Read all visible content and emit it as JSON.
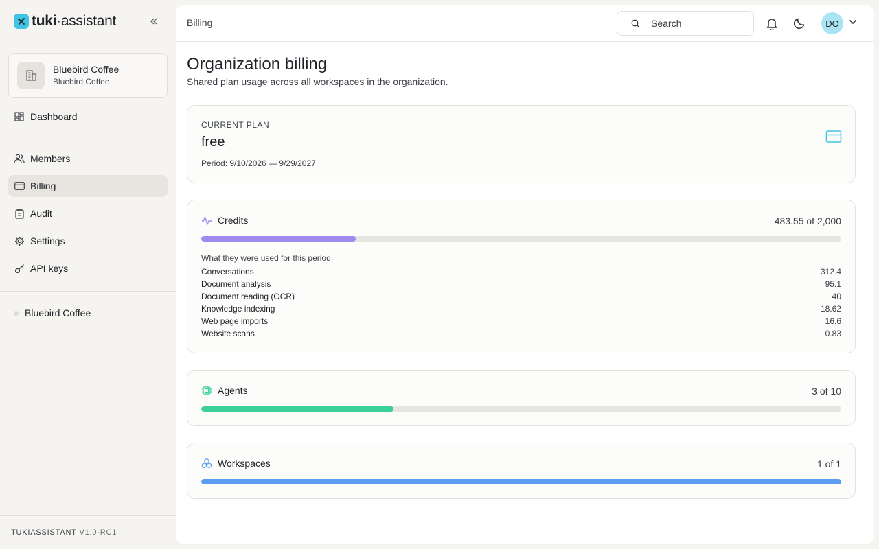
{
  "brand": {
    "name_bold": "tuki",
    "name_sep": "·",
    "name_rest": "assistant"
  },
  "org": {
    "name": "Bluebird Coffee",
    "subtitle": "Bluebird Coffee"
  },
  "nav": {
    "dashboard": "Dashboard",
    "members": "Members",
    "billing": "Billing",
    "audit": "Audit",
    "settings": "Settings",
    "api_keys": "API keys"
  },
  "workspaces": [
    {
      "name": "Bluebird Coffee"
    }
  ],
  "version": {
    "app": "TUKIASSISTANT",
    "ver": "V1.0-RC1"
  },
  "topbar": {
    "breadcrumb": "Billing",
    "search_placeholder": "Search",
    "user_initials": "DO"
  },
  "page": {
    "title": "Organization billing",
    "subtitle": "Shared plan usage across all workspaces in the organization."
  },
  "plan": {
    "eyebrow": "CURRENT PLAN",
    "name": "free",
    "period": "Period: 9/10/2026 — 9/29/2027",
    "icon": "credit-card-icon"
  },
  "credits": {
    "label": "Credits",
    "value_text": "483.55 of 2,000",
    "used": 483.55,
    "limit": 2000,
    "color": "#9f8aef",
    "breakdown_title": "What they were used for this period",
    "breakdown": [
      {
        "label": "Conversations",
        "value": "312.4"
      },
      {
        "label": "Document analysis",
        "value": "95.1"
      },
      {
        "label": "Document reading (OCR)",
        "value": "40"
      },
      {
        "label": "Knowledge indexing",
        "value": "18.62"
      },
      {
        "label": "Web page imports",
        "value": "16.6"
      },
      {
        "label": "Website scans",
        "value": "0.83"
      }
    ]
  },
  "agents": {
    "label": "Agents",
    "value_text": "3 of 10",
    "used": 3,
    "limit": 10,
    "color": "#3ccf9b"
  },
  "workspaces_usage": {
    "label": "Workspaces",
    "value_text": "1 of 1",
    "used": 1,
    "limit": 1,
    "color": "#5b9ef0"
  },
  "colors": {
    "accent": "#3fc4e3",
    "active_nav": "#e8e5e0"
  }
}
